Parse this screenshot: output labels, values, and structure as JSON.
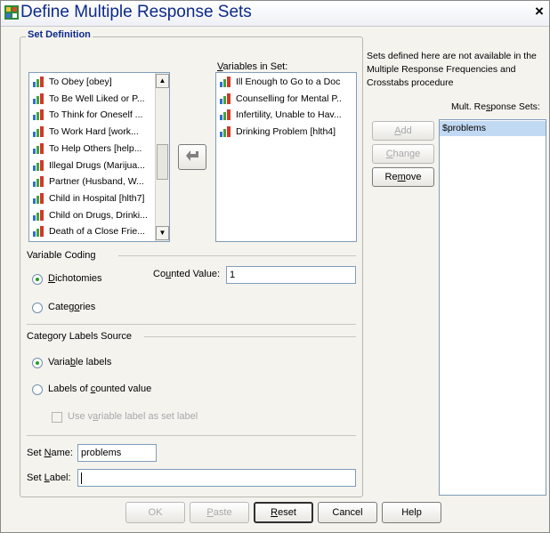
{
  "window": {
    "title": "Define Multiple Response Sets",
    "close": "×"
  },
  "set_definition": {
    "title": "Set Definition"
  },
  "source_list": {
    "items": [
      "To Obey [obey]",
      "To Be Well Liked or P...",
      "To Think for Oneself ...",
      "To Work Hard [work...",
      "To Help Others [help...",
      "Illegal Drugs (Marijua...",
      "Partner (Husband, W...",
      "Child in Hospital [hlth7]",
      "Child on Drugs, Drinki...",
      "Death of a Close Frie..."
    ]
  },
  "variables_in_set": {
    "label": "Variables in Set:",
    "items": [
      "Ill Enough to Go to a Doc...",
      "Counselling for Mental P...",
      "Infertility, Unable to Hav...",
      "Drinking Problem [hlth4]"
    ]
  },
  "variable_coding": {
    "title": "Variable Coding",
    "dichotomies": "Dichotomies",
    "categories": "Categories",
    "counted_value_label": "Counted Value:",
    "counted_value": "1"
  },
  "category_labels": {
    "title": "Category Labels Source",
    "variable_labels": "Variable labels",
    "labels_counted": "Labels of counted value",
    "use_var_label": "Use variable label as set label"
  },
  "set_name": {
    "label": "Set Name:",
    "value": "problems"
  },
  "set_label": {
    "label": "Set Label:",
    "value": ""
  },
  "info_text": "Sets defined here are not available in the Multiple Response Frequencies and Crosstabs procedure",
  "mult_sets": {
    "label": "Mult. Response Sets:",
    "items": [
      "$problems"
    ]
  },
  "side_buttons": {
    "add": "Add",
    "change": "Change",
    "remove": "Remove"
  },
  "footer": {
    "ok": "OK",
    "paste": "Paste",
    "reset": "Reset",
    "cancel": "Cancel",
    "help": "Help"
  },
  "colors": {
    "title_text": "#0c2a8a",
    "accent_green": "#21a121",
    "selection": "#c2d9f3"
  }
}
